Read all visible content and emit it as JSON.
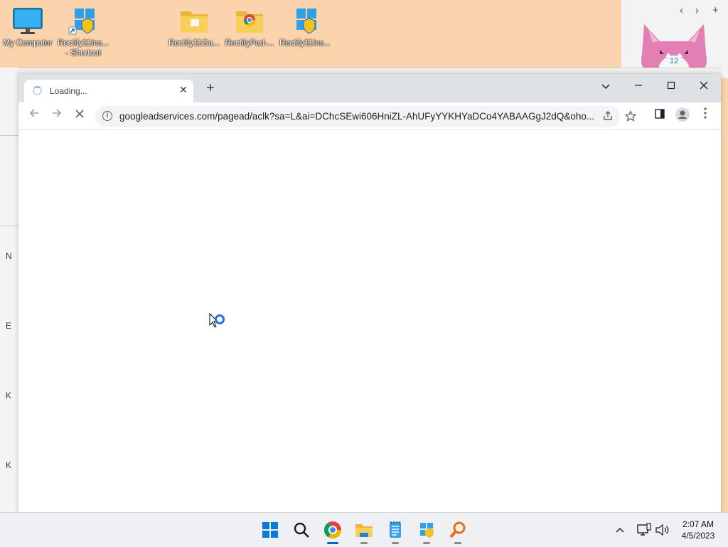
{
  "desktop": {
    "icons": [
      {
        "label": "My Computer",
        "label2": ""
      },
      {
        "label": "Rectify11Ins...",
        "label2": "- Shortcut"
      },
      {
        "label": "Rectify11Ga...",
        "label2": ""
      },
      {
        "label": "RectifyPad-...",
        "label2": ""
      },
      {
        "label": "Rectify11Ins...",
        "label2": ""
      }
    ]
  },
  "widget": {
    "prev": "‹",
    "next": "›",
    "add": "+",
    "clock_number": "12"
  },
  "background_window": {
    "edge_chars": [
      "N",
      "E",
      "K",
      "K"
    ]
  },
  "browser": {
    "tab_title": "Loading...",
    "tab_close": "✕",
    "new_tab": "+",
    "url": "googleadservices.com/pagead/aclk?sa=L&ai=DChcSEwi606HniZL-AhUFyYYKHYaDCo4YABAAGgJ2dQ&oho...",
    "controls": {
      "tab_search": "⌄",
      "minimize": "—",
      "maximize": "☐",
      "close": "✕"
    }
  },
  "taskbar": {
    "clock_time": "2:07 AM",
    "clock_date": "4/5/2023",
    "tray_chevron": "^"
  },
  "colors": {
    "desktop_bg": "#fbd3ac",
    "accent": "#0067c0",
    "tabstrip": "#dee1e6"
  }
}
